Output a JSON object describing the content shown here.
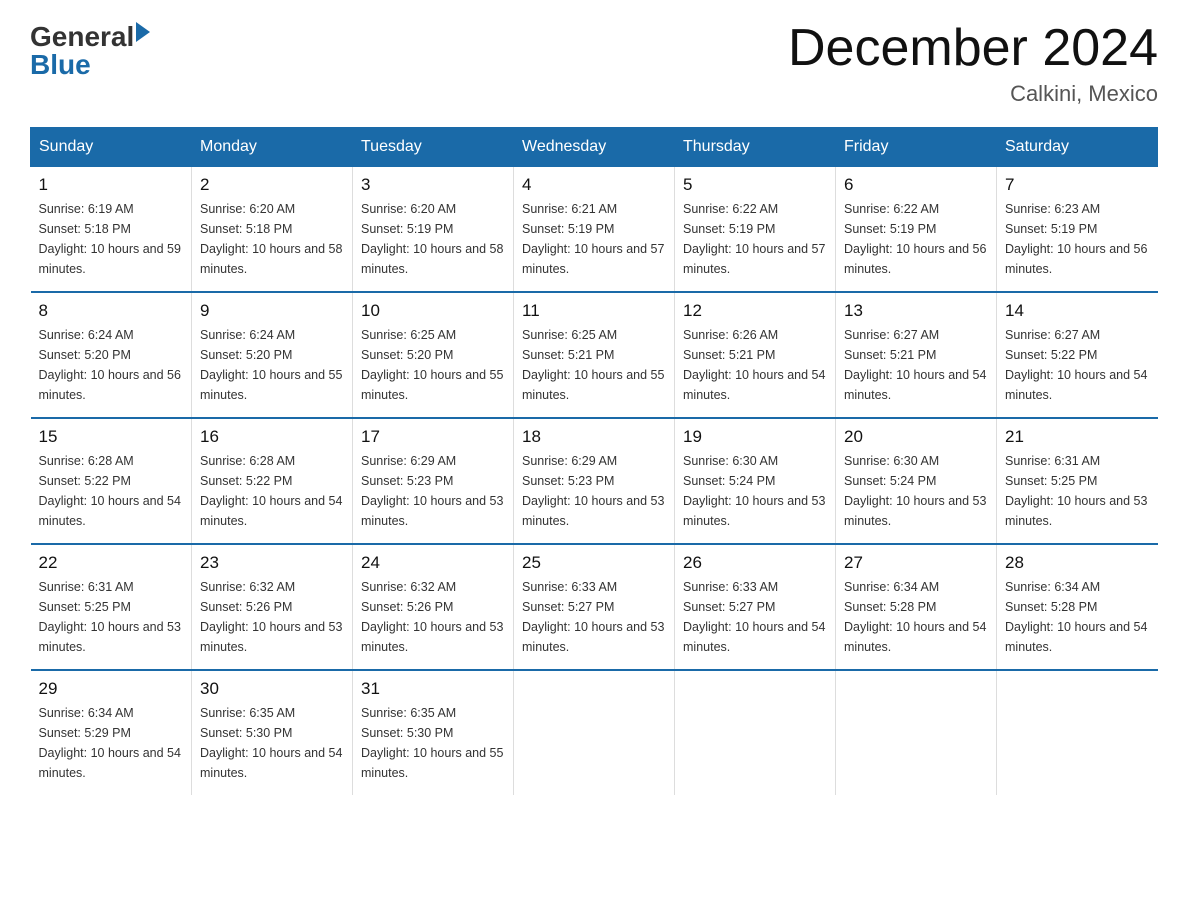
{
  "header": {
    "logo_general": "General",
    "logo_blue": "Blue",
    "title": "December 2024",
    "subtitle": "Calkini, Mexico"
  },
  "weekdays": [
    "Sunday",
    "Monday",
    "Tuesday",
    "Wednesday",
    "Thursday",
    "Friday",
    "Saturday"
  ],
  "weeks": [
    [
      {
        "day": "1",
        "sunrise": "6:19 AM",
        "sunset": "5:18 PM",
        "daylight": "10 hours and 59 minutes."
      },
      {
        "day": "2",
        "sunrise": "6:20 AM",
        "sunset": "5:18 PM",
        "daylight": "10 hours and 58 minutes."
      },
      {
        "day": "3",
        "sunrise": "6:20 AM",
        "sunset": "5:19 PM",
        "daylight": "10 hours and 58 minutes."
      },
      {
        "day": "4",
        "sunrise": "6:21 AM",
        "sunset": "5:19 PM",
        "daylight": "10 hours and 57 minutes."
      },
      {
        "day": "5",
        "sunrise": "6:22 AM",
        "sunset": "5:19 PM",
        "daylight": "10 hours and 57 minutes."
      },
      {
        "day": "6",
        "sunrise": "6:22 AM",
        "sunset": "5:19 PM",
        "daylight": "10 hours and 56 minutes."
      },
      {
        "day": "7",
        "sunrise": "6:23 AM",
        "sunset": "5:19 PM",
        "daylight": "10 hours and 56 minutes."
      }
    ],
    [
      {
        "day": "8",
        "sunrise": "6:24 AM",
        "sunset": "5:20 PM",
        "daylight": "10 hours and 56 minutes."
      },
      {
        "day": "9",
        "sunrise": "6:24 AM",
        "sunset": "5:20 PM",
        "daylight": "10 hours and 55 minutes."
      },
      {
        "day": "10",
        "sunrise": "6:25 AM",
        "sunset": "5:20 PM",
        "daylight": "10 hours and 55 minutes."
      },
      {
        "day": "11",
        "sunrise": "6:25 AM",
        "sunset": "5:21 PM",
        "daylight": "10 hours and 55 minutes."
      },
      {
        "day": "12",
        "sunrise": "6:26 AM",
        "sunset": "5:21 PM",
        "daylight": "10 hours and 54 minutes."
      },
      {
        "day": "13",
        "sunrise": "6:27 AM",
        "sunset": "5:21 PM",
        "daylight": "10 hours and 54 minutes."
      },
      {
        "day": "14",
        "sunrise": "6:27 AM",
        "sunset": "5:22 PM",
        "daylight": "10 hours and 54 minutes."
      }
    ],
    [
      {
        "day": "15",
        "sunrise": "6:28 AM",
        "sunset": "5:22 PM",
        "daylight": "10 hours and 54 minutes."
      },
      {
        "day": "16",
        "sunrise": "6:28 AM",
        "sunset": "5:22 PM",
        "daylight": "10 hours and 54 minutes."
      },
      {
        "day": "17",
        "sunrise": "6:29 AM",
        "sunset": "5:23 PM",
        "daylight": "10 hours and 53 minutes."
      },
      {
        "day": "18",
        "sunrise": "6:29 AM",
        "sunset": "5:23 PM",
        "daylight": "10 hours and 53 minutes."
      },
      {
        "day": "19",
        "sunrise": "6:30 AM",
        "sunset": "5:24 PM",
        "daylight": "10 hours and 53 minutes."
      },
      {
        "day": "20",
        "sunrise": "6:30 AM",
        "sunset": "5:24 PM",
        "daylight": "10 hours and 53 minutes."
      },
      {
        "day": "21",
        "sunrise": "6:31 AM",
        "sunset": "5:25 PM",
        "daylight": "10 hours and 53 minutes."
      }
    ],
    [
      {
        "day": "22",
        "sunrise": "6:31 AM",
        "sunset": "5:25 PM",
        "daylight": "10 hours and 53 minutes."
      },
      {
        "day": "23",
        "sunrise": "6:32 AM",
        "sunset": "5:26 PM",
        "daylight": "10 hours and 53 minutes."
      },
      {
        "day": "24",
        "sunrise": "6:32 AM",
        "sunset": "5:26 PM",
        "daylight": "10 hours and 53 minutes."
      },
      {
        "day": "25",
        "sunrise": "6:33 AM",
        "sunset": "5:27 PM",
        "daylight": "10 hours and 53 minutes."
      },
      {
        "day": "26",
        "sunrise": "6:33 AM",
        "sunset": "5:27 PM",
        "daylight": "10 hours and 54 minutes."
      },
      {
        "day": "27",
        "sunrise": "6:34 AM",
        "sunset": "5:28 PM",
        "daylight": "10 hours and 54 minutes."
      },
      {
        "day": "28",
        "sunrise": "6:34 AM",
        "sunset": "5:28 PM",
        "daylight": "10 hours and 54 minutes."
      }
    ],
    [
      {
        "day": "29",
        "sunrise": "6:34 AM",
        "sunset": "5:29 PM",
        "daylight": "10 hours and 54 minutes."
      },
      {
        "day": "30",
        "sunrise": "6:35 AM",
        "sunset": "5:30 PM",
        "daylight": "10 hours and 54 minutes."
      },
      {
        "day": "31",
        "sunrise": "6:35 AM",
        "sunset": "5:30 PM",
        "daylight": "10 hours and 55 minutes."
      },
      null,
      null,
      null,
      null
    ]
  ],
  "labels": {
    "sunrise_prefix": "Sunrise: ",
    "sunset_prefix": "Sunset: ",
    "daylight_prefix": "Daylight: "
  }
}
